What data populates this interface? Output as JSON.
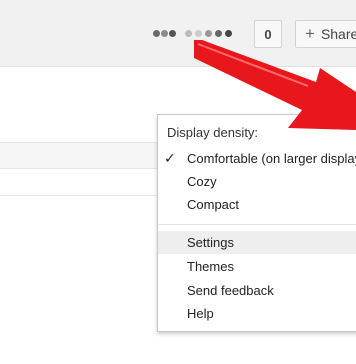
{
  "header": {
    "count": "0",
    "share_label": "Share",
    "share_icon": "plus-icon"
  },
  "menu": {
    "heading": "Display density:",
    "density_options": [
      {
        "label": "Comfortable (on larger displays)",
        "checked": true
      },
      {
        "label": "Cozy",
        "checked": false
      },
      {
        "label": "Compact",
        "checked": false
      }
    ],
    "check_glyph": "✓",
    "actions": [
      {
        "label": "Settings",
        "highlighted": true
      },
      {
        "label": "Themes",
        "highlighted": false
      },
      {
        "label": "Send feedback",
        "highlighted": false
      },
      {
        "label": "Help",
        "highlighted": false
      }
    ]
  },
  "colors": {
    "arrow": "#e8171b",
    "menu_border": "#c9c9c9",
    "highlight": "#eeeeee"
  }
}
